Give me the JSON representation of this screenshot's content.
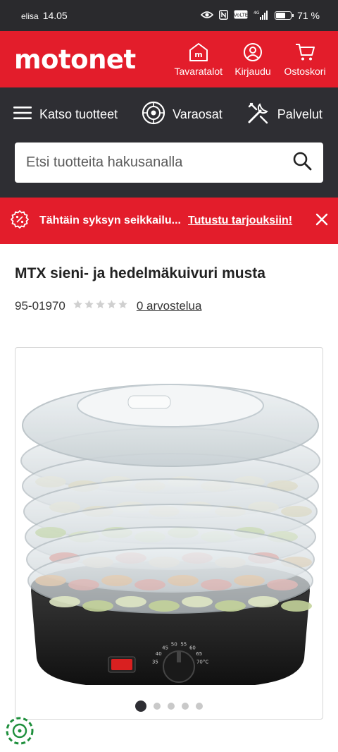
{
  "status_bar": {
    "carrier": "elisa",
    "time": "14.05",
    "battery_label": "71 %",
    "battery_level": 0.71,
    "network": "4G",
    "volte": "VoLTE"
  },
  "header": {
    "logo": "motonet",
    "actions": [
      {
        "label": "Tavaratalot",
        "icon": "store-icon"
      },
      {
        "label": "Kirjaudu",
        "icon": "user-icon"
      },
      {
        "label": "Ostoskori",
        "icon": "cart-icon"
      }
    ]
  },
  "nav": {
    "items": [
      {
        "label": "Katso tuotteet",
        "icon": "menu-icon"
      },
      {
        "label": "Varaosat",
        "icon": "tyre-icon"
      },
      {
        "label": "Palvelut",
        "icon": "tools-icon"
      }
    ]
  },
  "search": {
    "placeholder": "Etsi tuotteita hakusanalla"
  },
  "promo": {
    "text": "Tähtäin syksyn seikkailu...",
    "link": "Tutustu tarjouksiin!"
  },
  "product": {
    "title": "MTX sieni- ja hedelmäkuivuri musta",
    "sku": "95-01970",
    "rating": 0,
    "rating_max": 5,
    "reviews": "0 arvostelua"
  },
  "image": {
    "dial_labels": [
      "35",
      "40",
      "45",
      "50",
      "55",
      "60",
      "65",
      "70°C"
    ],
    "page_count": 5,
    "active_index": 0
  },
  "colors": {
    "brand_red": "#e31d2b",
    "dark_bar": "#2e2e33"
  }
}
